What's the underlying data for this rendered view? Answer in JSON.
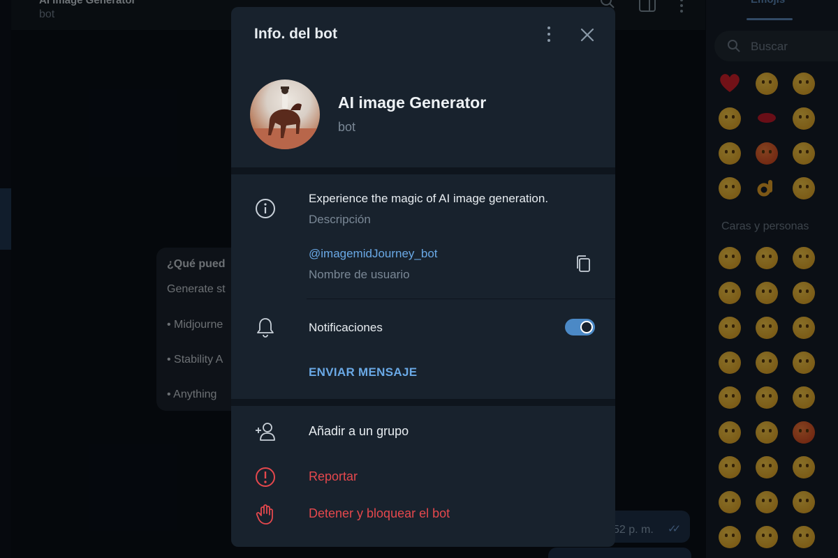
{
  "background": {
    "chat_title": "AI image Generator",
    "chat_subtitle": "bot",
    "bubble_lines": [
      "¿Qué pued",
      "Generate st",
      "• Midjourne",
      "• Stability A",
      "• Anything"
    ],
    "out_time": "52 p. m.",
    "out_ticks": "✓✓",
    "emoji_tab": "Emojis",
    "emoji_search_placeholder": "Buscar",
    "emoji_section": "Caras y personas"
  },
  "modal": {
    "title": "Info. del bot",
    "bot_name": "AI image Generator",
    "bot_type": "bot",
    "description": "Experience the magic of AI image generation.",
    "description_label": "Descripción",
    "username": "@imagemidJourney_bot",
    "username_label": "Nombre de usuario",
    "notifications_label": "Notificaciones",
    "notifications_on": true,
    "send_message": "ENVIAR MENSAJE",
    "add_to_group": "Añadir a un grupo",
    "report": "Reportar",
    "block": "Detener y bloquear el bot"
  },
  "colors": {
    "accent": "#6aa9e6",
    "toggle": "#4b89c6",
    "danger": "#e5484d",
    "modal_bg": "#18222d"
  }
}
